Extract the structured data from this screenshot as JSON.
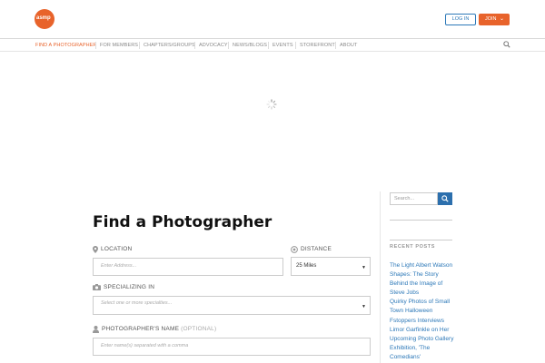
{
  "brand": {
    "logo_text": "asmp"
  },
  "header": {
    "login_label": "LOG IN",
    "join_label": "JOIN"
  },
  "nav": {
    "items": [
      "FIND A PHOTOGRAPHER",
      "FOR MEMBERS",
      "CHAPTERS/GROUPS",
      "ADVOCACY",
      "NEWS/BLOGS",
      "EVENTS",
      "STOREFRONT",
      "ABOUT"
    ]
  },
  "main": {
    "title": "Find a Photographer",
    "location": {
      "label": "LOCATION",
      "placeholder": "Enter Address..."
    },
    "distance": {
      "label": "DISTANCE",
      "value": "25 Miles"
    },
    "specializing": {
      "label": "SPECIALIZING IN",
      "placeholder": "Select one or more specialties..."
    },
    "name": {
      "label": "PHOTOGRAPHER'S NAME",
      "optional": "(OPTIONAL)",
      "placeholder": "Enter name(s) separated with a comma"
    }
  },
  "sidebar": {
    "search_placeholder": "Search...",
    "recent_heading": "RECENT POSTS",
    "posts": [
      "The Light Albert Watson Shapes: The Story Behind the Image of Steve Jobs",
      "Quirky Photos of Small Town Halloween",
      "Fstoppers Interviews Limor Garfinkle on Her Upcoming Photo Gallery Exhibition, 'The Comedians'"
    ]
  },
  "colors": {
    "accent": "#e8632b",
    "link": "#2c78b8",
    "search_button": "#2c6fad"
  },
  "icons": [
    "map-pin-icon",
    "compass-icon",
    "camera-icon",
    "person-icon",
    "search-icon",
    "loading-spinner-icon",
    "chevron-down-icon"
  ]
}
